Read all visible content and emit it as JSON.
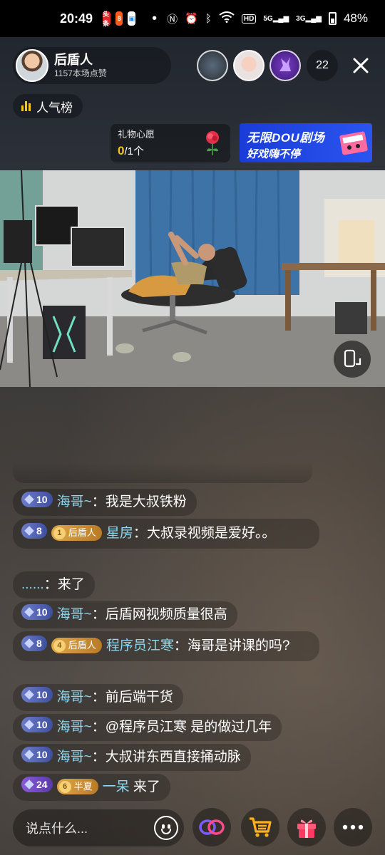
{
  "status_bar": {
    "time": "20:49",
    "apps": [
      "头条",
      "8"
    ],
    "signal_labels": [
      "5G",
      "3G"
    ],
    "hd_label": "HD",
    "battery": "48%"
  },
  "host": {
    "name": "后盾人",
    "likes": "1157本场点赞"
  },
  "viewer_count": "22",
  "popularity_label": "人气榜",
  "gift_wish": {
    "title": "礼物心愿",
    "current": "0",
    "rest": "/1个"
  },
  "banner": {
    "line1": "无限DOU剧场",
    "line2": "好戏嗨不停"
  },
  "messages": [
    {
      "level": "10",
      "user": "海哥~",
      "text": "我是大叔铁粉"
    },
    {
      "level": "8",
      "fan_level": "1",
      "fan_club": "后盾人",
      "user": "星房",
      "text": "大叔录视频是爱好。。"
    },
    {
      "user": "......",
      "text": "来了"
    },
    {
      "level": "10",
      "user": "海哥~",
      "text": "后盾网视频质量很高"
    },
    {
      "level": "8",
      "fan_level": "4",
      "fan_club": "后盾人",
      "user": "程序员江寒",
      "text": "海哥是讲课的吗?"
    },
    {
      "level": "10",
      "user": "海哥~",
      "text": "前后端干货"
    },
    {
      "level": "10",
      "user": "海哥~",
      "text": "@程序员江寒 是的做过几年"
    },
    {
      "level": "10",
      "user": "海哥~",
      "text": "大叔讲东西直接捅动脉"
    },
    {
      "level": "24",
      "fan_level": "6",
      "fan_club": "半夏",
      "user": "一呆",
      "text": "来了"
    }
  ],
  "input_placeholder": "说点什么...",
  "colors": {
    "username": "#8fd8f0",
    "gold": "#f5c518",
    "banner_blue": "#2a55f0"
  }
}
